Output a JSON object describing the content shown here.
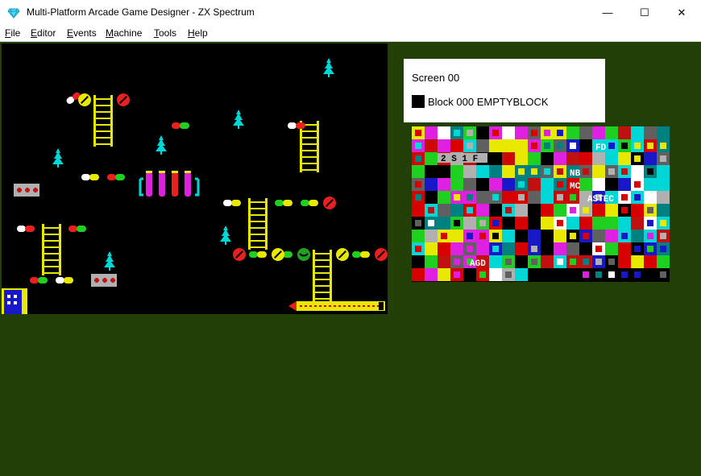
{
  "window": {
    "title": "Multi-Platform Arcade Game Designer - ZX Spectrum",
    "minimize_glyph": "—",
    "maximize_glyph": "☐",
    "close_glyph": "✕"
  },
  "menu": [
    {
      "accel": "F",
      "rest": "ile"
    },
    {
      "accel": "E",
      "rest": "ditor"
    },
    {
      "accel": "E",
      "rest": "vents"
    },
    {
      "accel": "M",
      "rest": "achine"
    },
    {
      "accel": "T",
      "rest": "ools"
    },
    {
      "accel": "H",
      "rest": "elp"
    }
  ],
  "info": {
    "screen_label": "Screen 00",
    "block_label": "Block 000 EMPTYBLOCK"
  },
  "palette_text": {
    "t1": "2 S 1 F",
    "t2": "ASTEC",
    "t3": "FD",
    "t4": "NB",
    "t5": "MC",
    "t6": "A",
    "t7": "AGD"
  },
  "colors": {
    "background": "#233f08",
    "game_screen": "#000000",
    "palette": "#000000",
    "panel": "#ffffff"
  },
  "icons": {
    "app": "diamond-icon",
    "ladder": "ladder-sprite",
    "tree": "tree-sprite",
    "pill": "pill-sprite",
    "ball": "ball-sprite",
    "crate": "crate-sprite",
    "door": "door-sprite",
    "rocket": "rocket-sprite"
  }
}
